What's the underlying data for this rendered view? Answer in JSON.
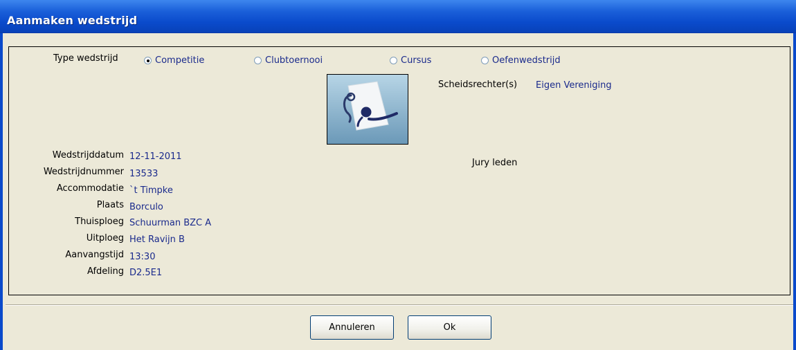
{
  "window": {
    "title": "Aanmaken wedstrijd"
  },
  "type_section": {
    "label": "Type wedstrijd",
    "options": [
      "Competitie",
      "Clubtoernooi",
      "Cursus",
      "Oefenwedstrijd"
    ],
    "selected": "Competitie"
  },
  "referee": {
    "label": "Scheidsrechter(s)",
    "value": "Eigen Vereniging"
  },
  "jury": {
    "label": "Jury leden"
  },
  "fields": [
    {
      "label": "Wedstrijddatum",
      "value": "12-11-2011"
    },
    {
      "label": "Wedstrijdnummer",
      "value": "13533"
    },
    {
      "label": "Accommodatie",
      "value": "`t Timpke"
    },
    {
      "label": "Plaats",
      "value": "Borculo"
    },
    {
      "label": "Thuisploeg",
      "value": "Schuurman BZC A"
    },
    {
      "label": "Uitploeg",
      "value": "Het Ravijn B"
    },
    {
      "label": "Aanvangstijd",
      "value": "13:30"
    },
    {
      "label": "Afdeling",
      "value": "D2.5E1"
    }
  ],
  "buttons": {
    "cancel": "Annuleren",
    "ok": "Ok"
  },
  "logo": {
    "icon": "korfball-player-logo-icon"
  },
  "colors": {
    "title_bar": "#0A4ACB",
    "value_text": "#1A2A8C",
    "window_bg": "#ECE9D8"
  }
}
